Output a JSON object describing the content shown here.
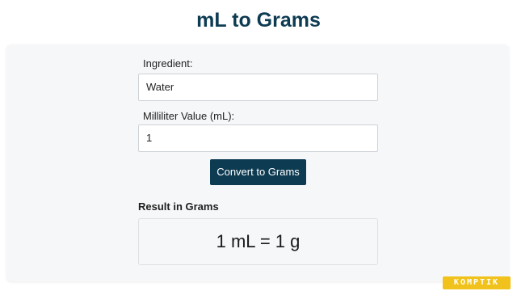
{
  "page": {
    "title": "mL to Grams"
  },
  "form": {
    "ingredient_label": "Ingredient:",
    "ingredient_value": "Water",
    "ml_label": "Milliliter Value (mL):",
    "ml_value": "1",
    "convert_button": "Convert to Grams"
  },
  "result": {
    "heading": "Result in Grams",
    "text": "1 mL = 1 g"
  },
  "watermark": {
    "text": "KOMPTIK"
  },
  "colors": {
    "title": "#0d3b52",
    "button_bg": "#0d3b52",
    "panel_bg": "#f6f7f9",
    "watermark_bg": "#f0c21b"
  }
}
